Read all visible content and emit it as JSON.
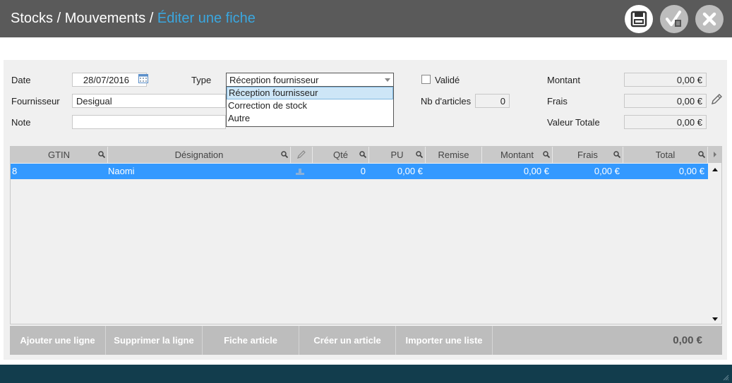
{
  "header": {
    "crumb1": "Stocks",
    "sep1": "/",
    "crumb2": "Mouvements",
    "sep2": "/",
    "current": "Éditer une fiche",
    "accent_color": "#3aa7e0"
  },
  "toolbar": {
    "save_icon": "save-icon",
    "validate_icon": "validate-icon",
    "close_icon": "close-icon"
  },
  "form": {
    "date_label": "Date",
    "date_value": "28/07/2016",
    "type_label": "Type",
    "type_value": "Réception fournisseur",
    "type_options": [
      "Réception fournisseur",
      "Correction de stock",
      "Autre"
    ],
    "valide_label": "Validé",
    "fournisseur_label": "Fournisseur",
    "fournisseur_value": "Desigual",
    "nb_articles_label": "Nb d'articles",
    "nb_articles_value": "0",
    "note_label": "Note",
    "note_value": "",
    "montant_label": "Montant",
    "montant_value": "0,00 €",
    "frais_label": "Frais",
    "frais_value": "0,00 €",
    "valeur_totale_label": "Valeur Totale",
    "valeur_totale_value": "0,00 €"
  },
  "table": {
    "columns": [
      "GTIN",
      "Désignation",
      "Qté",
      "PU",
      "Remise",
      "Montant",
      "Frais",
      "Total"
    ],
    "rows": [
      {
        "gtin": "8",
        "designation": "Naomi",
        "qte": "0",
        "pu": "0,00 €",
        "remise": "",
        "montant": "0,00 €",
        "frais": "0,00 €",
        "total": "0,00 €"
      }
    ]
  },
  "actions": {
    "add_line": "Ajouter une ligne",
    "delete_line": "Supprimer la ligne",
    "article_sheet": "Fiche article",
    "create_article": "Créer un article",
    "import_list": "Importer une liste",
    "grand_total": "0,00 €"
  }
}
